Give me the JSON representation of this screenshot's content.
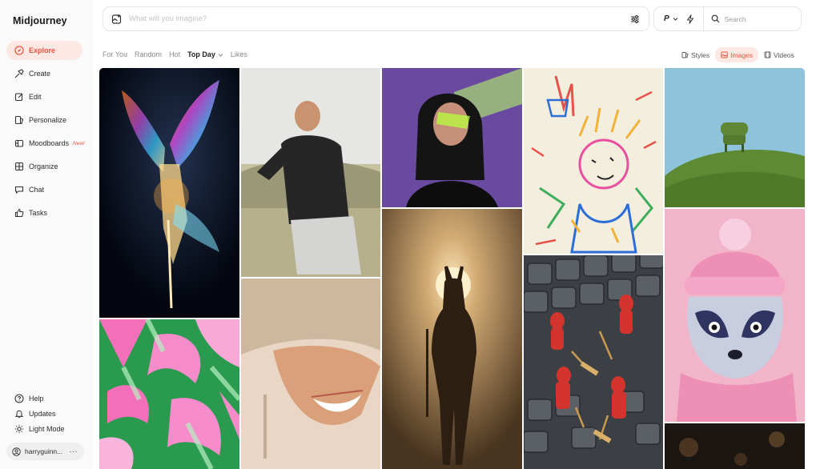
{
  "app": {
    "brand": "Midjourney"
  },
  "sidebar": {
    "items": [
      {
        "label": "Explore",
        "icon": "compass-icon",
        "active": true
      },
      {
        "label": "Create",
        "icon": "brush-icon"
      },
      {
        "label": "Edit",
        "icon": "edit-icon"
      },
      {
        "label": "Personalize",
        "icon": "personalize-icon"
      },
      {
        "label": "Moodboards",
        "icon": "moodboard-icon",
        "badge": "New!"
      },
      {
        "label": "Organize",
        "icon": "grid-icon"
      },
      {
        "label": "Chat",
        "icon": "chat-icon"
      },
      {
        "label": "Tasks",
        "icon": "thumbs-up-icon"
      }
    ],
    "bottom": [
      {
        "label": "Help",
        "icon": "help-icon"
      },
      {
        "label": "Updates",
        "icon": "bell-icon"
      },
      {
        "label": "Light Mode",
        "icon": "sun-icon"
      }
    ],
    "user": {
      "name": "harryguinn...",
      "more": "···"
    }
  },
  "prompt": {
    "placeholder": "What will you imagine?"
  },
  "tools": {
    "p_label": "P",
    "search_placeholder": "Search"
  },
  "filters": {
    "tabs": [
      "For You",
      "Random",
      "Hot",
      "Top Day",
      "Likes"
    ],
    "active": "Top Day"
  },
  "type_tabs": [
    {
      "label": "Styles",
      "icon": "styles-icon"
    },
    {
      "label": "Images",
      "icon": "image-icon",
      "active": true
    },
    {
      "label": "Videos",
      "icon": "video-icon"
    }
  ],
  "colors": {
    "accent": "#e8543e",
    "accent_bg": "#fde8e4"
  }
}
